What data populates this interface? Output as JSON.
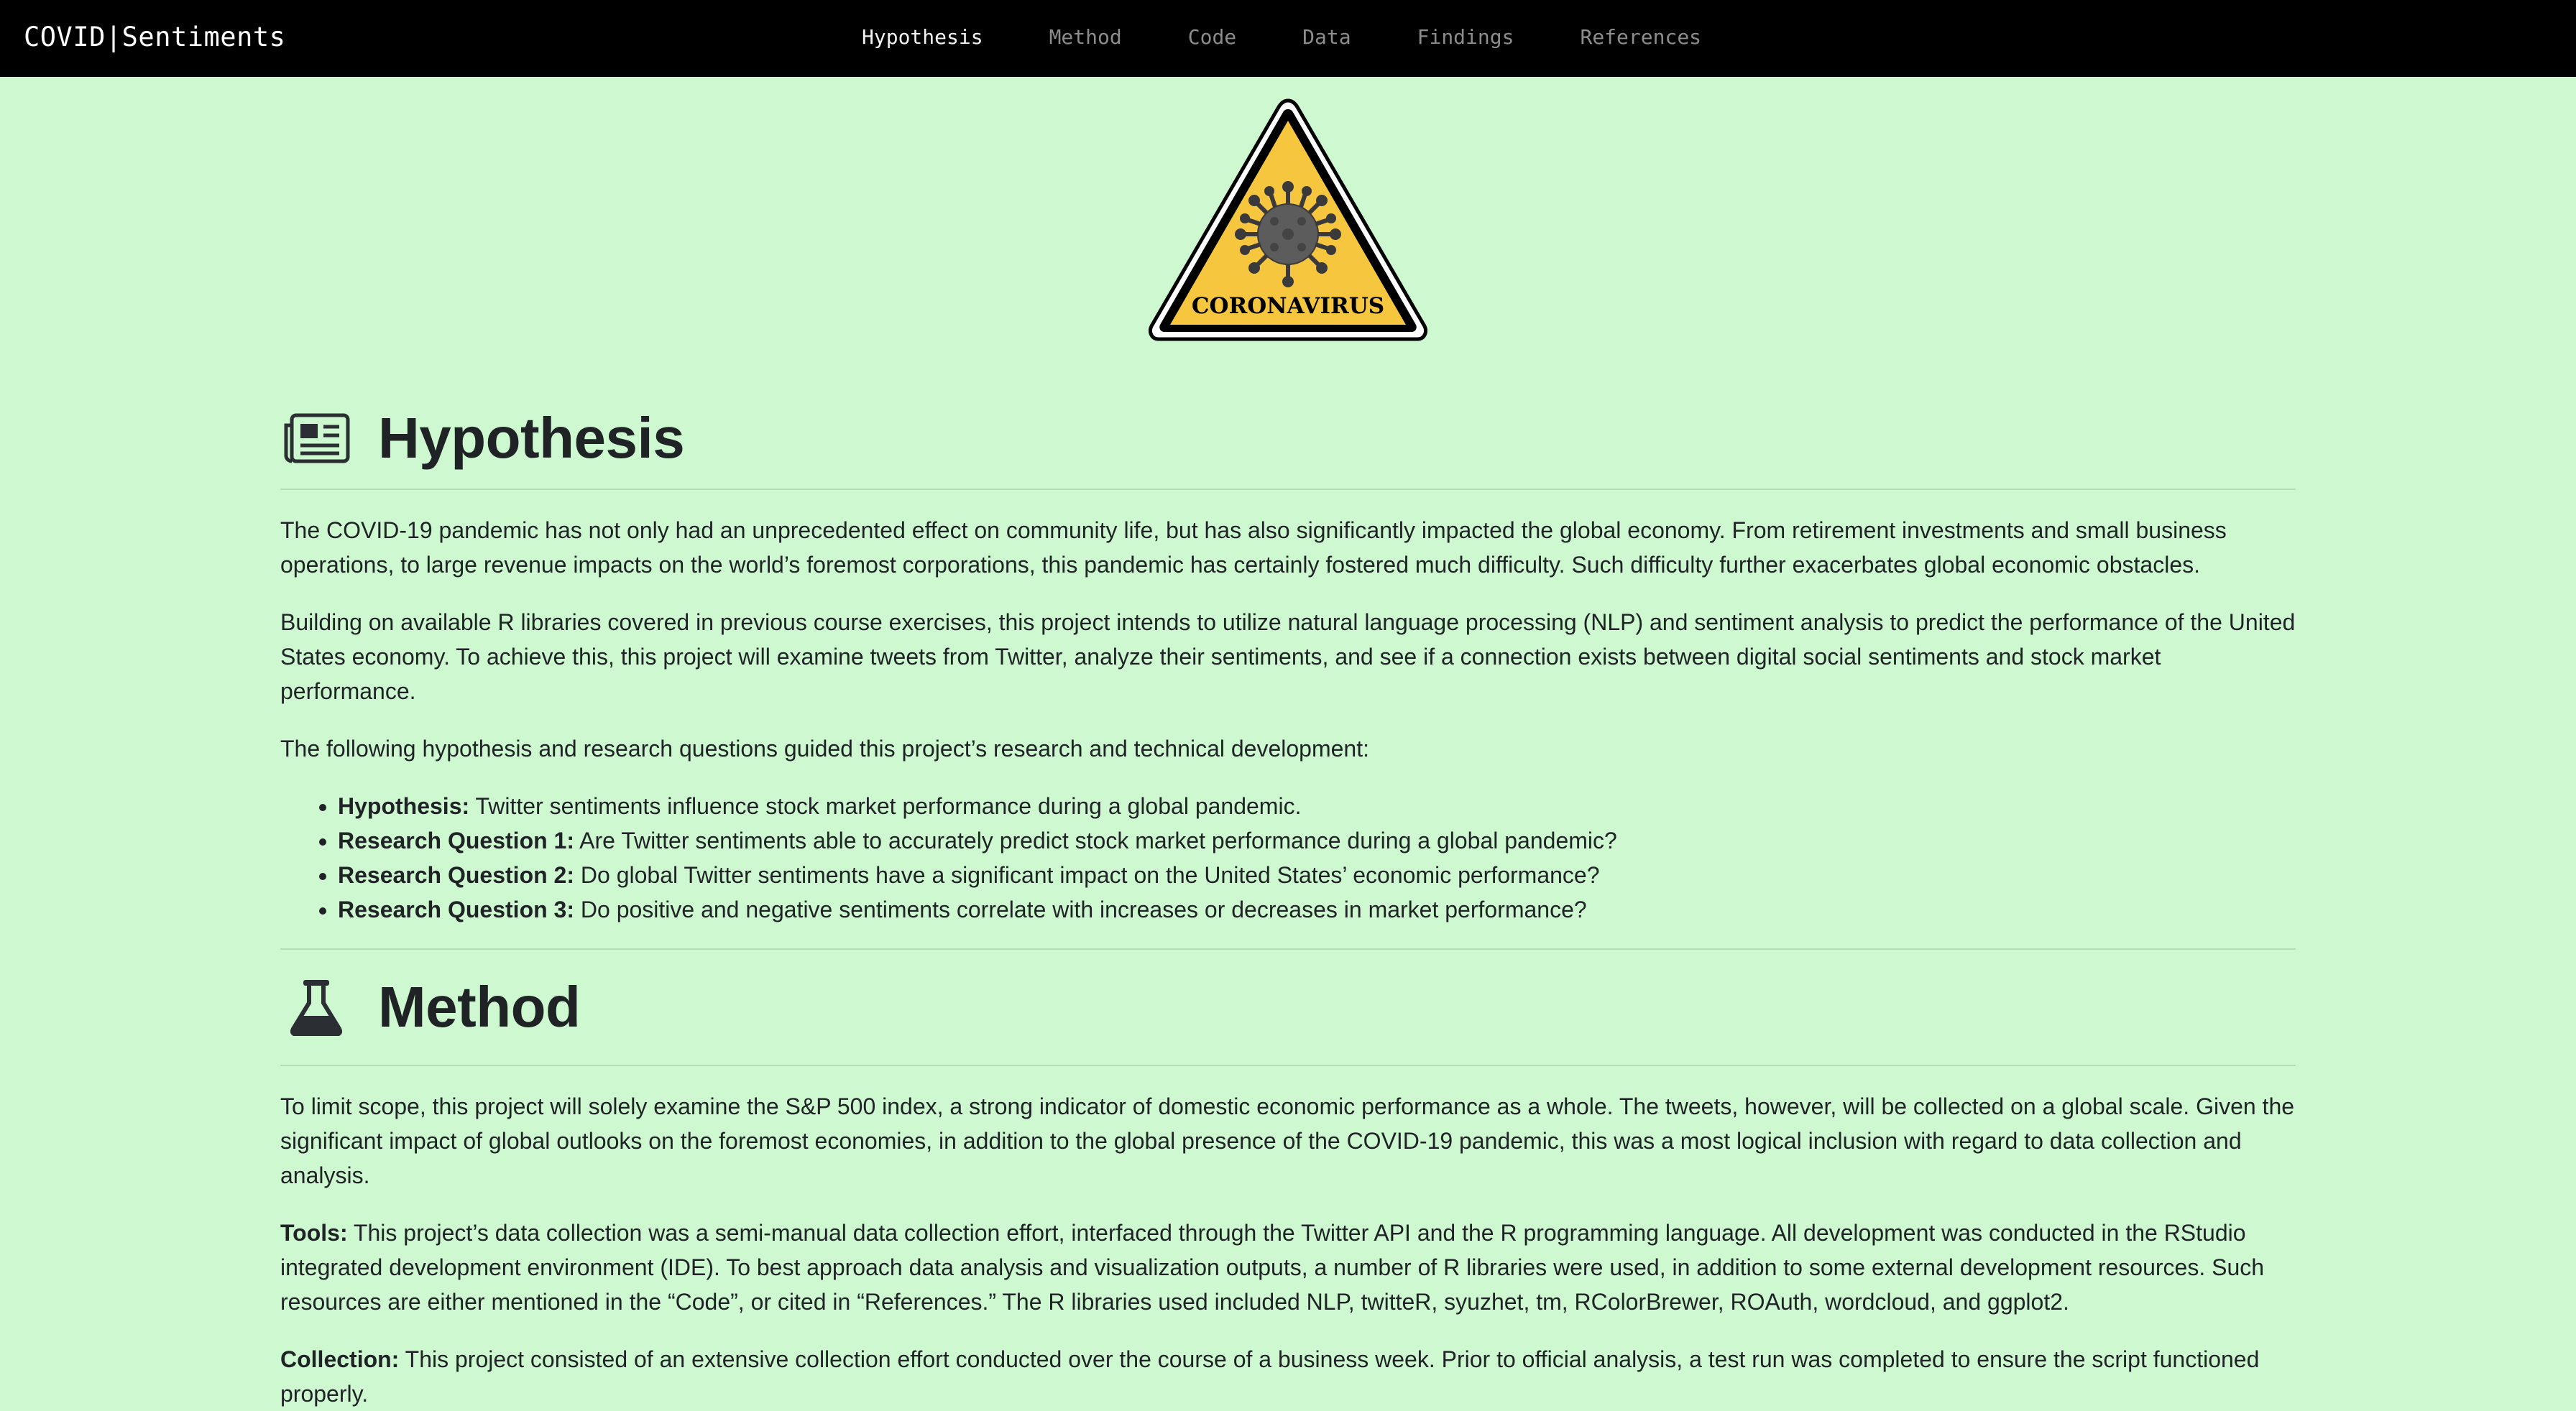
{
  "nav": {
    "brand": "COVID|Sentiments",
    "links": [
      "Hypothesis",
      "Method",
      "Code",
      "Data",
      "Findings",
      "References"
    ],
    "active": "Hypothesis"
  },
  "hero": {
    "sign_text": "CORONAVIRUS",
    "colors": {
      "sign_fill": "#f7c63f",
      "virus": "#5c5c5c",
      "outline": "#000000"
    }
  },
  "hypothesis": {
    "icon": "newspaper-icon",
    "title": "Hypothesis",
    "paragraphs": [
      "The COVID-19 pandemic has not only had an unprecedented effect on community life, but has also significantly impacted the global economy. From retirement investments and small business operations, to large revenue impacts on the world’s foremost corporations, this pandemic has certainly fostered much difficulty. Such difficulty further exacerbates global economic obstacles.",
      "Building on available R libraries covered in previous course exercises, this project intends to utilize natural language processing (NLP) and sentiment analysis to predict the performance of the United States economy. To achieve this, this project will examine tweets from Twitter, analyze their sentiments, and see if a connection exists between digital social sentiments and stock market performance.",
      "The following hypothesis and research questions guided this project’s research and technical development:"
    ],
    "items": [
      {
        "label": "Hypothesis:",
        "text": " Twitter sentiments influence stock market performance during a global pandemic."
      },
      {
        "label": "Research Question 1:",
        "text": " Are Twitter sentiments able to accurately predict stock market performance during a global pandemic?"
      },
      {
        "label": "Research Question 2:",
        "text": " Do global Twitter sentiments have a significant impact on the United States’ economic performance?"
      },
      {
        "label": "Research Question 3:",
        "text": " Do positive and negative sentiments correlate with increases or decreases in market performance?"
      }
    ]
  },
  "method": {
    "icon": "flask-icon",
    "title": "Method",
    "intro": "To limit scope, this project will solely examine the S&P 500 index, a strong indicator of domestic economic performance as a whole. The tweets, however, will be collected on a global scale. Given the significant impact of global outlooks on the foremost economies, in addition to the global presence of the COVID-19 pandemic, this was a most logical inclusion with regard to data collection and analysis.",
    "tools_label": "Tools:",
    "tools_text": " This project’s data collection was a semi-manual data collection effort, interfaced through the Twitter API and the R programming language. All development was conducted in the RStudio integrated development environment (IDE). To best approach data analysis and visualization outputs, a number of R libraries were used, in addition to some external development resources. Such resources are either mentioned in the “Code”, or cited in “References.” The R libraries used included NLP, twitteR, syuzhet, tm, RColorBrewer, ROAuth, wordcloud, and ggplot2.",
    "collection_label": "Collection:",
    "collection_text": " This project consisted of an extensive collection effort conducted over the course of a business week. Prior to official analysis, a test run was completed to ensure the script functioned properly."
  }
}
